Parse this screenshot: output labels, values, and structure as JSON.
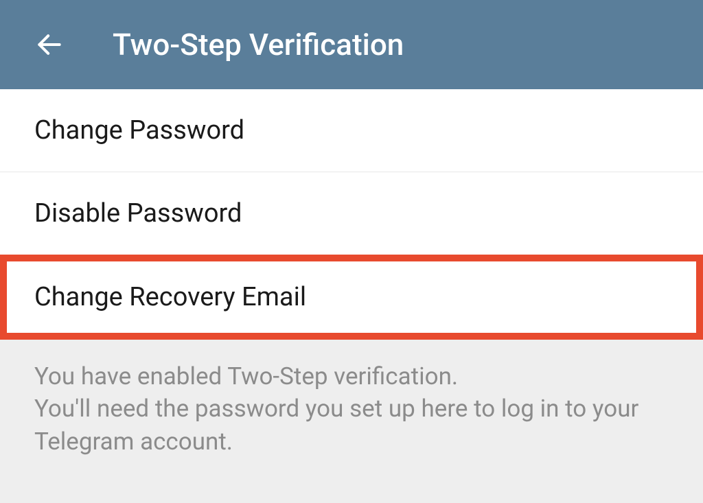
{
  "header": {
    "title": "Two-Step Verification"
  },
  "options": {
    "change_password": "Change Password",
    "disable_password": "Disable Password",
    "change_recovery_email": "Change Recovery Email"
  },
  "info": "You have enabled Two-Step verification.\nYou'll need the password you set up here to log in to your Telegram account."
}
